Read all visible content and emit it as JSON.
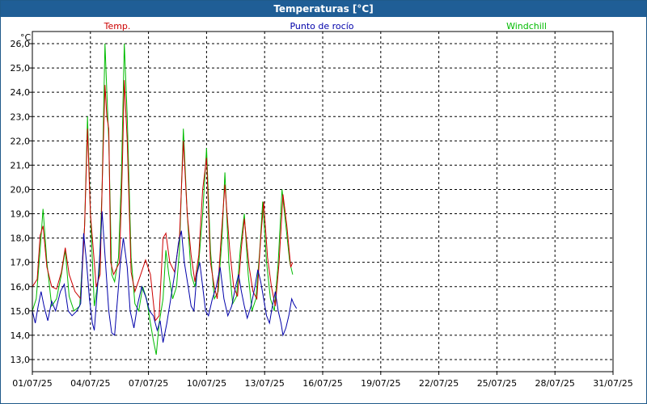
{
  "window": {
    "title": "Temperaturas [°C]"
  },
  "chart_data": {
    "type": "line",
    "title": "Temperaturas [°C]",
    "ylabel": "°C",
    "ylim": [
      12.5,
      26.5
    ],
    "yticks": [
      "13,0",
      "14,0",
      "15,0",
      "16,0",
      "17,0",
      "18,0",
      "19,0",
      "20,0",
      "21,0",
      "22,0",
      "23,0",
      "24,0",
      "25,0",
      "26,0"
    ],
    "xlim": [
      0,
      30
    ],
    "xticks": [
      {
        "x": 0,
        "label": "01/07/25"
      },
      {
        "x": 3,
        "label": "04/07/25"
      },
      {
        "x": 6,
        "label": "07/07/25"
      },
      {
        "x": 9,
        "label": "10/07/25"
      },
      {
        "x": 12,
        "label": "13/07/25"
      },
      {
        "x": 15,
        "label": "16/07/25"
      },
      {
        "x": 18,
        "label": "19/07/25"
      },
      {
        "x": 21,
        "label": "22/07/25"
      },
      {
        "x": 24,
        "label": "25/07/25"
      },
      {
        "x": 27,
        "label": "28/07/25"
      },
      {
        "x": 30,
        "label": "31/07/25"
      }
    ],
    "grid": true,
    "series": [
      {
        "name": "Temp.",
        "color": "#cc0000",
        "points": [
          [
            0.0,
            16.0
          ],
          [
            0.25,
            16.3
          ],
          [
            0.4,
            18.1
          ],
          [
            0.55,
            18.5
          ],
          [
            0.75,
            16.8
          ],
          [
            1.0,
            16.0
          ],
          [
            1.25,
            15.9
          ],
          [
            1.5,
            16.6
          ],
          [
            1.7,
            17.6
          ],
          [
            1.9,
            16.5
          ],
          [
            2.2,
            15.8
          ],
          [
            2.5,
            15.5
          ],
          [
            2.7,
            18.5
          ],
          [
            2.85,
            22.5
          ],
          [
            3.0,
            19.0
          ],
          [
            3.3,
            16.0
          ],
          [
            3.5,
            16.5
          ],
          [
            3.6,
            20.0
          ],
          [
            3.75,
            24.3
          ],
          [
            3.85,
            23.0
          ],
          [
            3.95,
            22.5
          ],
          [
            4.05,
            17.0
          ],
          [
            4.2,
            16.5
          ],
          [
            4.5,
            17.0
          ],
          [
            4.65,
            21.0
          ],
          [
            4.75,
            24.5
          ],
          [
            4.9,
            22.0
          ],
          [
            5.1,
            16.6
          ],
          [
            5.3,
            15.8
          ],
          [
            5.6,
            16.5
          ],
          [
            5.85,
            17.1
          ],
          [
            6.1,
            16.5
          ],
          [
            6.35,
            14.6
          ],
          [
            6.55,
            14.8
          ],
          [
            6.75,
            18.0
          ],
          [
            6.9,
            18.2
          ],
          [
            7.1,
            17.0
          ],
          [
            7.35,
            16.6
          ],
          [
            7.6,
            18.0
          ],
          [
            7.8,
            22.0
          ],
          [
            8.0,
            19.0
          ],
          [
            8.2,
            17.3
          ],
          [
            8.4,
            16.2
          ],
          [
            8.6,
            17.3
          ],
          [
            8.8,
            20.0
          ],
          [
            9.0,
            21.3
          ],
          [
            9.2,
            17.0
          ],
          [
            9.4,
            16.0
          ],
          [
            9.55,
            15.5
          ],
          [
            9.75,
            18.0
          ],
          [
            9.95,
            20.2
          ],
          [
            10.2,
            17.5
          ],
          [
            10.4,
            16.0
          ],
          [
            10.6,
            15.6
          ],
          [
            10.8,
            17.6
          ],
          [
            10.95,
            18.8
          ],
          [
            11.2,
            16.8
          ],
          [
            11.4,
            15.8
          ],
          [
            11.6,
            15.5
          ],
          [
            11.8,
            18.0
          ],
          [
            11.95,
            19.5
          ],
          [
            12.15,
            17.2
          ],
          [
            12.35,
            16.0
          ],
          [
            12.55,
            15.2
          ],
          [
            12.75,
            17.0
          ],
          [
            12.95,
            19.8
          ],
          [
            13.15,
            18.5
          ],
          [
            13.35,
            16.8
          ],
          [
            13.45,
            17.0
          ]
        ]
      },
      {
        "name": "Punto de rocío",
        "color": "#0000aa",
        "points": [
          [
            0.0,
            15.0
          ],
          [
            0.15,
            14.5
          ],
          [
            0.3,
            15.2
          ],
          [
            0.45,
            15.8
          ],
          [
            0.6,
            15.2
          ],
          [
            0.8,
            14.6
          ],
          [
            1.0,
            15.4
          ],
          [
            1.2,
            15.0
          ],
          [
            1.45,
            15.8
          ],
          [
            1.65,
            16.1
          ],
          [
            1.85,
            15.0
          ],
          [
            2.05,
            14.8
          ],
          [
            2.3,
            15.0
          ],
          [
            2.5,
            15.3
          ],
          [
            2.65,
            18.2
          ],
          [
            2.8,
            17.0
          ],
          [
            2.95,
            15.5
          ],
          [
            3.1,
            14.5
          ],
          [
            3.2,
            14.2
          ],
          [
            3.35,
            15.8
          ],
          [
            3.5,
            17.5
          ],
          [
            3.6,
            19.1
          ],
          [
            3.75,
            17.3
          ],
          [
            3.95,
            15.0
          ],
          [
            4.1,
            14.1
          ],
          [
            4.25,
            14.0
          ],
          [
            4.4,
            15.5
          ],
          [
            4.55,
            17.0
          ],
          [
            4.7,
            18.0
          ],
          [
            4.9,
            16.8
          ],
          [
            5.05,
            15.0
          ],
          [
            5.25,
            14.3
          ],
          [
            5.45,
            15.3
          ],
          [
            5.65,
            16.0
          ],
          [
            5.85,
            15.6
          ],
          [
            6.05,
            15.0
          ],
          [
            6.25,
            14.8
          ],
          [
            6.45,
            14.2
          ],
          [
            6.6,
            14.6
          ],
          [
            6.75,
            13.7
          ],
          [
            6.95,
            14.5
          ],
          [
            7.15,
            15.5
          ],
          [
            7.35,
            16.5
          ],
          [
            7.55,
            17.8
          ],
          [
            7.7,
            18.3
          ],
          [
            7.85,
            17.0
          ],
          [
            8.05,
            16.0
          ],
          [
            8.2,
            15.2
          ],
          [
            8.35,
            15.0
          ],
          [
            8.5,
            16.5
          ],
          [
            8.65,
            17.0
          ],
          [
            8.8,
            16.0
          ],
          [
            8.95,
            15.0
          ],
          [
            9.1,
            14.8
          ],
          [
            9.3,
            15.5
          ],
          [
            9.5,
            16.0
          ],
          [
            9.7,
            16.8
          ],
          [
            9.9,
            15.5
          ],
          [
            10.1,
            14.8
          ],
          [
            10.3,
            15.2
          ],
          [
            10.5,
            16.0
          ],
          [
            10.65,
            16.5
          ],
          [
            10.8,
            15.8
          ],
          [
            10.95,
            15.2
          ],
          [
            11.1,
            14.7
          ],
          [
            11.3,
            15.2
          ],
          [
            11.5,
            16.0
          ],
          [
            11.65,
            16.7
          ],
          [
            11.8,
            16.2
          ],
          [
            11.95,
            15.5
          ],
          [
            12.1,
            14.8
          ],
          [
            12.25,
            14.5
          ],
          [
            12.4,
            15.2
          ],
          [
            12.55,
            15.8
          ],
          [
            12.7,
            15.0
          ],
          [
            12.85,
            14.5
          ],
          [
            12.95,
            14.0
          ],
          [
            13.1,
            14.3
          ],
          [
            13.25,
            14.8
          ],
          [
            13.4,
            15.5
          ],
          [
            13.5,
            15.3
          ],
          [
            13.65,
            15.1
          ]
        ]
      },
      {
        "name": "Windchill",
        "color": "#00bb00",
        "points": [
          [
            0.0,
            15.0
          ],
          [
            0.2,
            15.5
          ],
          [
            0.4,
            17.5
          ],
          [
            0.55,
            19.2
          ],
          [
            0.75,
            17.0
          ],
          [
            1.0,
            15.2
          ],
          [
            1.25,
            15.5
          ],
          [
            1.5,
            16.5
          ],
          [
            1.7,
            17.5
          ],
          [
            1.9,
            15.6
          ],
          [
            2.15,
            15.0
          ],
          [
            2.45,
            15.2
          ],
          [
            2.7,
            18.5
          ],
          [
            2.85,
            23.0
          ],
          [
            3.0,
            19.0
          ],
          [
            3.2,
            15.2
          ],
          [
            3.45,
            16.5
          ],
          [
            3.6,
            20.0
          ],
          [
            3.75,
            26.0
          ],
          [
            3.85,
            24.0
          ],
          [
            3.95,
            22.0
          ],
          [
            4.1,
            16.5
          ],
          [
            4.25,
            16.2
          ],
          [
            4.45,
            17.2
          ],
          [
            4.6,
            20.5
          ],
          [
            4.75,
            26.0
          ],
          [
            4.9,
            23.0
          ],
          [
            5.1,
            17.2
          ],
          [
            5.3,
            15.3
          ],
          [
            5.5,
            15.0
          ],
          [
            5.7,
            16.0
          ],
          [
            5.9,
            15.5
          ],
          [
            6.1,
            14.5
          ],
          [
            6.25,
            13.8
          ],
          [
            6.4,
            13.2
          ],
          [
            6.55,
            14.5
          ],
          [
            6.75,
            15.5
          ],
          [
            6.9,
            17.5
          ],
          [
            7.05,
            16.5
          ],
          [
            7.25,
            15.5
          ],
          [
            7.45,
            16.0
          ],
          [
            7.6,
            17.5
          ],
          [
            7.8,
            22.5
          ],
          [
            8.0,
            19.0
          ],
          [
            8.2,
            16.5
          ],
          [
            8.4,
            16.0
          ],
          [
            8.6,
            17.0
          ],
          [
            8.8,
            19.0
          ],
          [
            9.0,
            21.7
          ],
          [
            9.2,
            17.5
          ],
          [
            9.4,
            15.5
          ],
          [
            9.6,
            15.8
          ],
          [
            9.8,
            18.0
          ],
          [
            9.95,
            20.7
          ],
          [
            10.15,
            17.0
          ],
          [
            10.35,
            15.3
          ],
          [
            10.55,
            15.6
          ],
          [
            10.75,
            17.6
          ],
          [
            10.95,
            19.0
          ],
          [
            11.15,
            16.5
          ],
          [
            11.35,
            15.0
          ],
          [
            11.55,
            15.5
          ],
          [
            11.75,
            17.5
          ],
          [
            11.9,
            19.5
          ],
          [
            12.1,
            17.0
          ],
          [
            12.3,
            15.5
          ],
          [
            12.5,
            15.0
          ],
          [
            12.7,
            17.0
          ],
          [
            12.9,
            20.0
          ],
          [
            13.1,
            18.5
          ],
          [
            13.3,
            17.0
          ],
          [
            13.45,
            16.5
          ]
        ]
      }
    ]
  }
}
